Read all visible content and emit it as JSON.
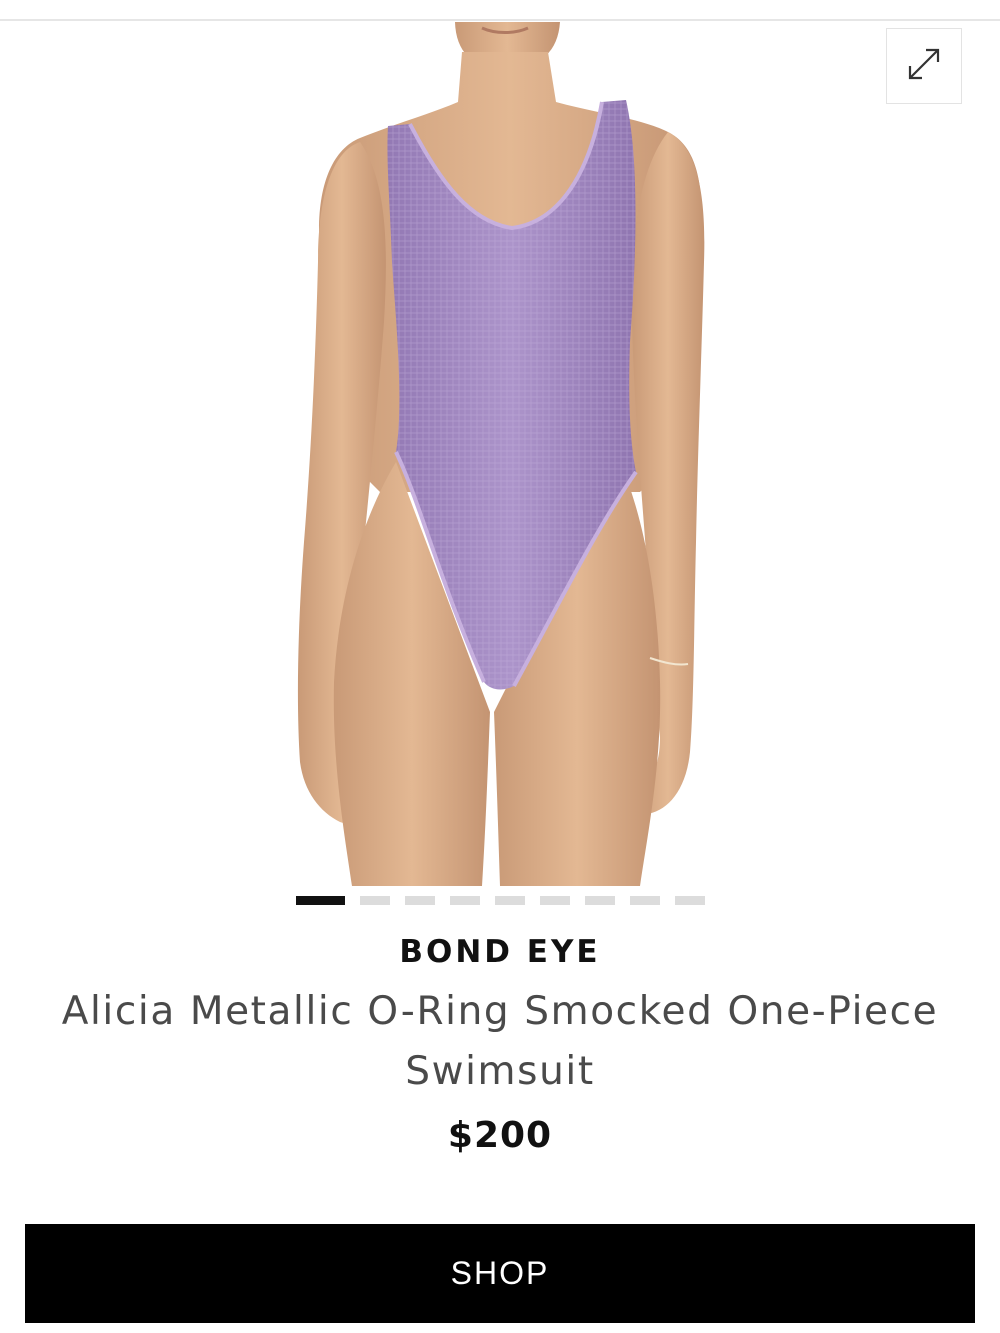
{
  "product": {
    "brand": "BOND EYE",
    "name": "Alicia Metallic O-Ring Smocked One-Piece Swimsuit",
    "price": "$200",
    "swimsuit_color": "#a28ac2"
  },
  "gallery": {
    "image_description": "Model wearing a lilac metallic smocked one-piece swimsuit",
    "expand_icon": "expand-arrows-icon",
    "slide_count": 9,
    "active_slide": 1
  },
  "actions": {
    "shop_label": "SHOP"
  },
  "colors": {
    "button_bg": "#000000",
    "button_text": "#ffffff",
    "dot_active": "#111111",
    "dot_inactive": "#dcdcdc"
  }
}
